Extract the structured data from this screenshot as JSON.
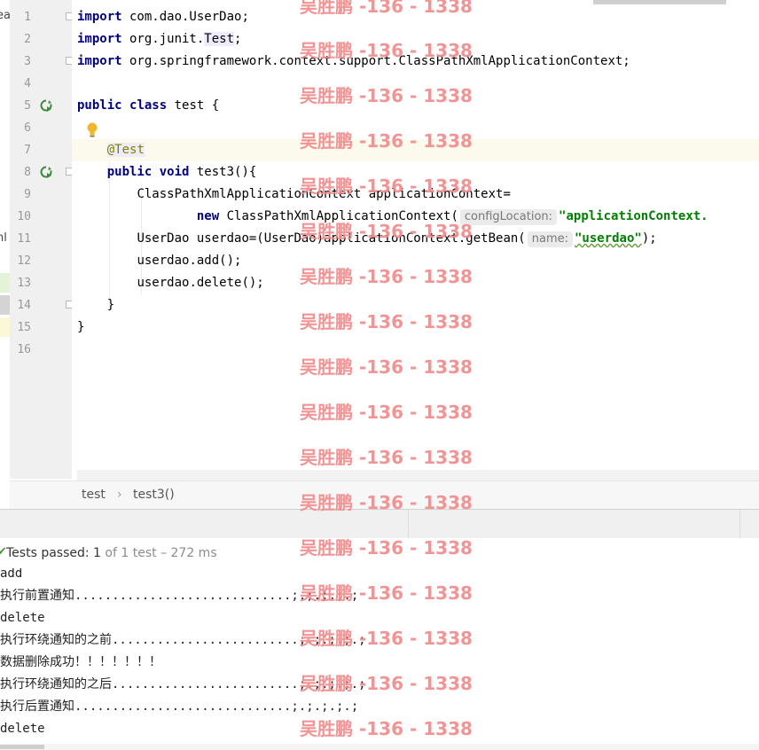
{
  "left_strip": {
    "frag_top": "ea",
    "frag_mid": "nl"
  },
  "line_numbers": [
    "1",
    "2",
    "3",
    "4",
    "5",
    "6",
    "7",
    "8",
    "9",
    "10",
    "11",
    "12",
    "13",
    "14",
    "15",
    "16"
  ],
  "code": {
    "l1": {
      "kw": "import",
      "rest": " com.dao.UserDao;"
    },
    "l2": {
      "kw": "import",
      "pre": " org.junit.",
      "ref": "Test",
      "post": ";"
    },
    "l3": {
      "kw": "import",
      "rest": " org.springframework.context.support.ClassPathXmlApplicationContext;"
    },
    "l5": {
      "kw1": "public",
      "kw2": "class",
      "rest": " test {"
    },
    "l7": {
      "ann_at": "@",
      "ann_name": "Test"
    },
    "l8": {
      "kw1": "public",
      "kw2": "void",
      "rest": " test3(){"
    },
    "l9": {
      "text": "ClassPathXmlApplicationContext applicationContext="
    },
    "l10": {
      "kw": "new",
      "pre": " ClassPathXmlApplicationContext(",
      "hint": "configLocation:",
      "str": "\"applicationContext."
    },
    "l11": {
      "pre": "UserDao userdao=(UserDao)applicationContext.getBean(",
      "hint": "name:",
      "str": "\"userdao\"",
      "post": ");"
    },
    "l12": {
      "text": "userdao.add();"
    },
    "l13": {
      "text": "userdao.delete();"
    },
    "l14": {
      "text": "}"
    },
    "l15": {
      "text": "}"
    }
  },
  "breadcrumb": {
    "class": "test",
    "sep": "›",
    "method": "test3()"
  },
  "status": {
    "check": "✔",
    "passed": "Tests passed: ",
    "count": "1",
    "rest": " of 1 test – 272 ms"
  },
  "console": [
    "add",
    "执行前置通知.............................;.;.;.;.;",
    "delete",
    "执行环绕通知的之前.........................;.;.;.;.;",
    "数据删除成功！！！！！！！",
    "执行环绕通知的之后.........................;.;.;.;.;",
    "执行后置通知.............................;.;.;.;.;",
    "delete"
  ],
  "watermark": "吴胜鹏 -136 - 1338",
  "colors": {
    "keyword": "#000080",
    "string": "#008000",
    "annotation": "#808000",
    "caret_line": "#fcfaed",
    "watermark": "#f28c8c"
  }
}
